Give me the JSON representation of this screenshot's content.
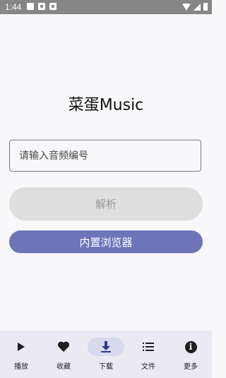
{
  "status_bar": {
    "time": "1:44"
  },
  "app": {
    "title": "菜蛋Music"
  },
  "search": {
    "placeholder": "请输入音频编号",
    "value": ""
  },
  "buttons": {
    "parse": "解析",
    "browser": "内置浏览器"
  },
  "nav": {
    "items": [
      {
        "label": "播放",
        "icon": "play-icon"
      },
      {
        "label": "收藏",
        "icon": "heart-icon"
      },
      {
        "label": "下载",
        "icon": "download-icon",
        "active": true
      },
      {
        "label": "文件",
        "icon": "list-icon"
      },
      {
        "label": "更多",
        "icon": "info-icon"
      }
    ]
  },
  "colors": {
    "accent": "#6d74b8",
    "nav_bg": "#ebeaf2",
    "active_pill": "#d7d9ee",
    "disabled_button": "#dedede"
  }
}
